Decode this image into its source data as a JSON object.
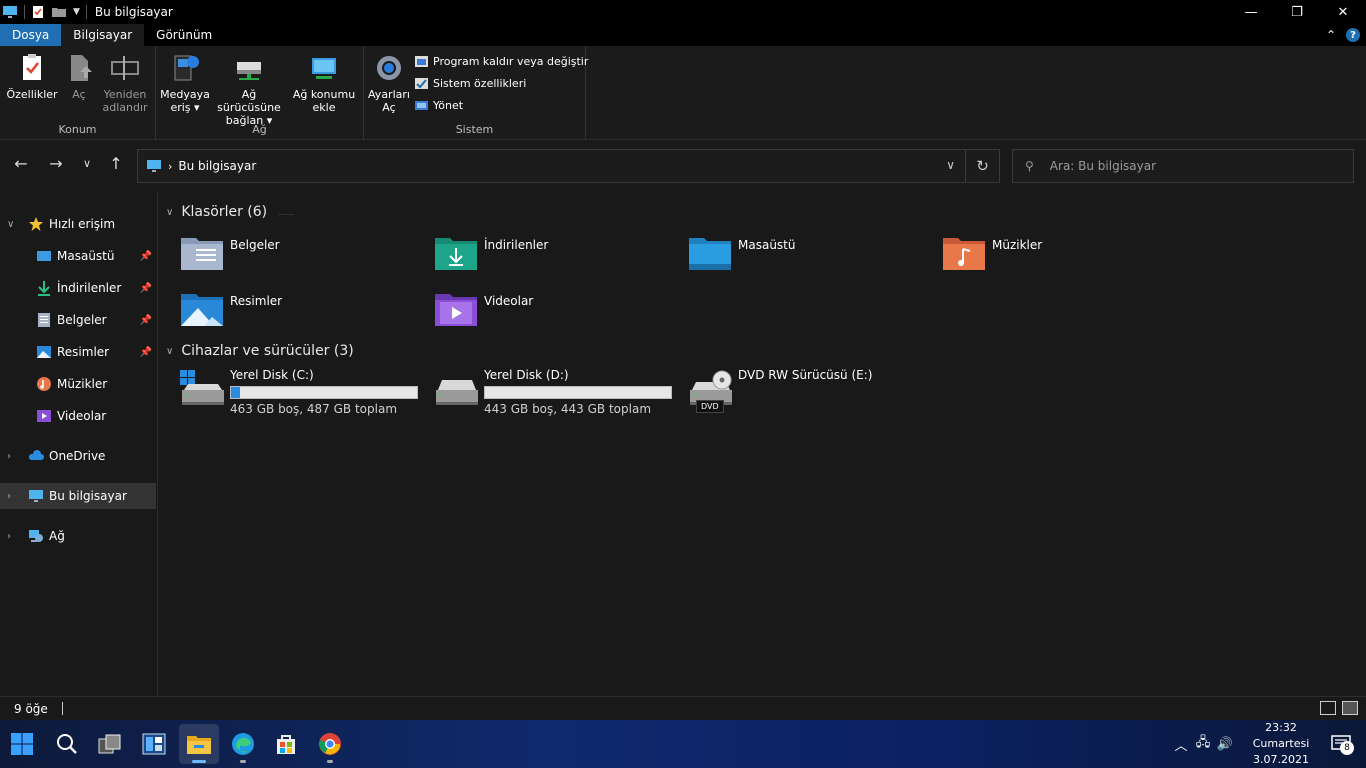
{
  "window": {
    "title": "Bu bilgisayar"
  },
  "tabs": {
    "file": "Dosya",
    "computer": "Bilgisayar",
    "view": "Görünüm"
  },
  "ribbon": {
    "location": {
      "label": "Konum",
      "properties": "Özellikler",
      "open": "Aç",
      "rename_line1": "Yeniden",
      "rename_line2": "adlandır"
    },
    "network": {
      "label": "Ağ",
      "media_line1": "Medyaya",
      "media_line2": "eriş",
      "map_line1": "Ağ sürücüsüne",
      "map_line2": "bağlan",
      "addloc_line1": "Ağ konumu",
      "addloc_line2": "ekle"
    },
    "system": {
      "label": "Sistem",
      "settings_line1": "Ayarları",
      "settings_line2": "Aç",
      "uninstall": "Program kaldır veya değiştir",
      "sysprops": "Sistem özellikleri",
      "manage": "Yönet"
    }
  },
  "address": {
    "crumb": "Bu bilgisayar",
    "search_placeholder": "Ara: Bu bilgisayar"
  },
  "sidebar": {
    "quick_access": "Hızlı erişim",
    "items": [
      {
        "label": "Masaüstü",
        "pinned": true,
        "icon": "desktop-icon"
      },
      {
        "label": "İndirilenler",
        "pinned": true,
        "icon": "downloads-icon"
      },
      {
        "label": "Belgeler",
        "pinned": true,
        "icon": "documents-icon"
      },
      {
        "label": "Resimler",
        "pinned": true,
        "icon": "pictures-icon"
      },
      {
        "label": "Müzikler",
        "pinned": false,
        "icon": "music-icon"
      },
      {
        "label": "Videolar",
        "pinned": false,
        "icon": "videos-icon"
      }
    ],
    "onedrive": "OneDrive",
    "this_pc": "Bu bilgisayar",
    "network": "Ağ"
  },
  "folders": {
    "header": "Klasörler (6)",
    "items": [
      {
        "name": "Belgeler",
        "icon": "documents-folder-icon",
        "color": "#8a9bb8"
      },
      {
        "name": "İndirilenler",
        "icon": "downloads-folder-icon",
        "color": "#1da58a"
      },
      {
        "name": "Masaüstü",
        "icon": "desktop-folder-icon",
        "color": "#2a9de0"
      },
      {
        "name": "Müzikler",
        "icon": "music-folder-icon",
        "color": "#e8784a"
      },
      {
        "name": "Resimler",
        "icon": "pictures-folder-icon",
        "color": "#2a88d8"
      },
      {
        "name": "Videolar",
        "icon": "videos-folder-icon",
        "color": "#8a4fd6"
      }
    ]
  },
  "drives": {
    "header": "Cihazlar ve sürücüler (3)",
    "items": [
      {
        "name": "Yerel Disk (C:)",
        "info": "463 GB boş, 487 GB toplam",
        "used_fraction": 0.05
      },
      {
        "name": "Yerel Disk (D:)",
        "info": "443 GB boş, 443 GB toplam",
        "used_fraction": 0.0
      },
      {
        "name": "DVD RW Sürücüsü (E:)",
        "badge": "DVD"
      }
    ]
  },
  "status": {
    "count": "9 öğe"
  },
  "taskbar": {
    "time": "23:32",
    "day": "Cumartesi",
    "date": "3.07.2021",
    "notifications": "8"
  },
  "colors": {
    "accent": "#1f6fb2",
    "progress": "#2a8be0",
    "background": "#191919"
  }
}
